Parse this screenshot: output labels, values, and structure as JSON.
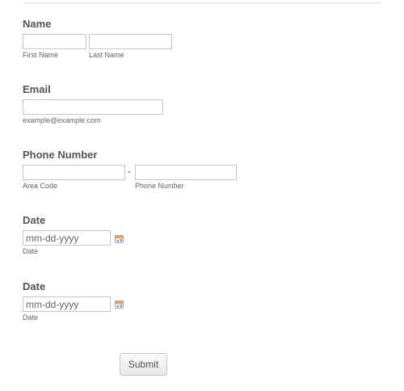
{
  "form": {
    "name": {
      "label": "Name",
      "first_value": "",
      "last_value": "",
      "first_sublabel": "First Name",
      "last_sublabel": "Last Name"
    },
    "email": {
      "label": "Email",
      "value": "",
      "sublabel": "example@example.com"
    },
    "phone": {
      "label": "Phone Number",
      "area_value": "",
      "number_value": "",
      "separator": "-",
      "area_sublabel": "Area Code",
      "number_sublabel": "Phone Number"
    },
    "date1": {
      "label": "Date",
      "placeholder": "mm-dd-yyyy",
      "value": "",
      "sublabel": "Date",
      "icon": "calendar-icon"
    },
    "date2": {
      "label": "Date",
      "placeholder": "mm-dd-yyyy",
      "value": "",
      "sublabel": "Date",
      "icon": "calendar-icon"
    },
    "submit_label": "Submit"
  },
  "colors": {
    "text": "#555555",
    "border": "#c6c6c6",
    "button_bg": "#efefef"
  }
}
